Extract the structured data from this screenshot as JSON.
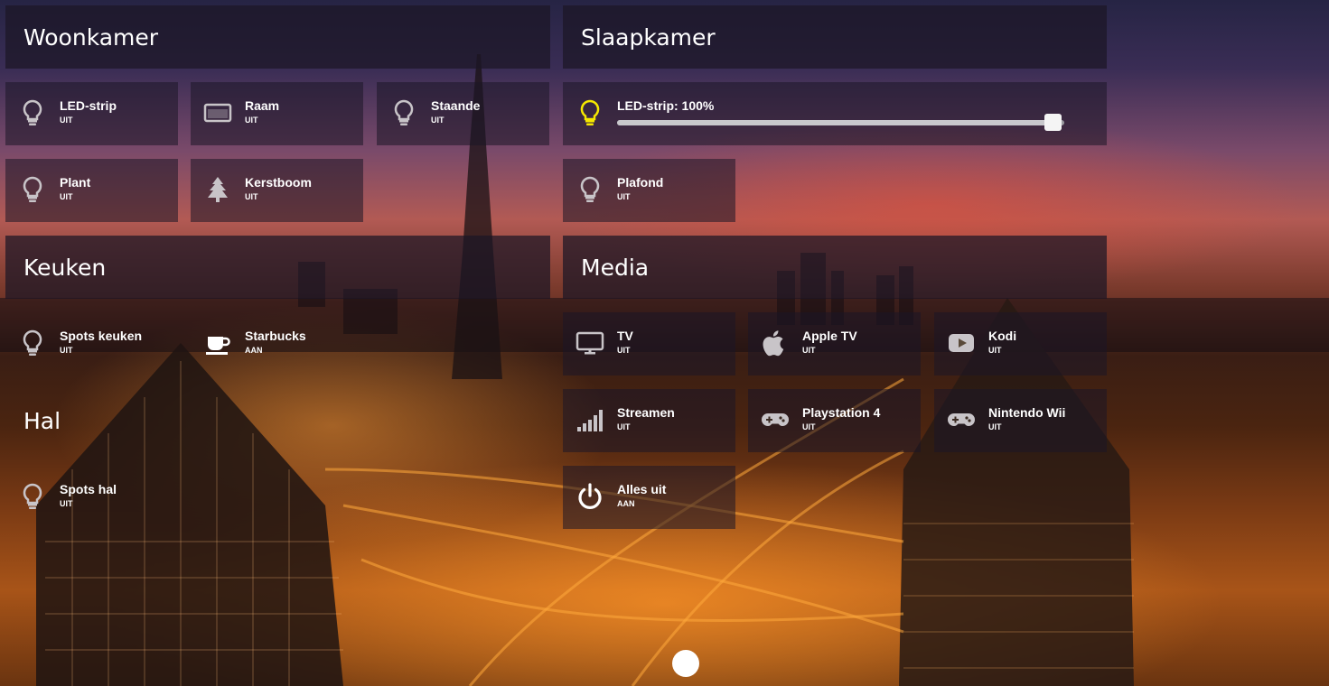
{
  "rooms": {
    "woonkamer": "Woonkamer",
    "slaapkamer": "Slaapkamer",
    "keuken": "Keuken",
    "media": "Media",
    "hal": "Hal"
  },
  "tiles": {
    "ledstrip_woon": {
      "name": "LED-strip",
      "state": "UIT",
      "icon": "bulb-icon"
    },
    "raam": {
      "name": "Raam",
      "state": "UIT",
      "icon": "window-icon"
    },
    "staande": {
      "name": "Staande",
      "state": "UIT",
      "icon": "bulb-icon"
    },
    "plant": {
      "name": "Plant",
      "state": "UIT",
      "icon": "bulb-icon"
    },
    "kerstboom": {
      "name": "Kerstboom",
      "state": "UIT",
      "icon": "tree-icon"
    },
    "plafond": {
      "name": "Plafond",
      "state": "UIT",
      "icon": "bulb-icon"
    },
    "spots_keuken": {
      "name": "Spots keuken",
      "state": "UIT",
      "icon": "bulb-icon"
    },
    "starbucks": {
      "name": "Starbucks",
      "state": "AAN",
      "icon": "coffee-cup-icon"
    },
    "tv": {
      "name": "TV",
      "state": "UIT",
      "icon": "monitor-icon"
    },
    "apple_tv": {
      "name": "Apple TV",
      "state": "UIT",
      "icon": "apple-icon"
    },
    "kodi": {
      "name": "Kodi",
      "state": "UIT",
      "icon": "youtube-icon"
    },
    "streamen": {
      "name": "Streamen",
      "state": "UIT",
      "icon": "signal-bars-icon"
    },
    "playstation": {
      "name": "Playstation 4",
      "state": "UIT",
      "icon": "gamepad-icon"
    },
    "wii": {
      "name": "Nintendo Wii",
      "state": "UIT",
      "icon": "gamepad-icon"
    },
    "spots_hal": {
      "name": "Spots hal",
      "state": "UIT",
      "icon": "bulb-icon"
    },
    "alles_uit": {
      "name": "Alles uit",
      "state": "AAN",
      "icon": "power-icon"
    }
  },
  "slaapkamer_ledstrip": {
    "label": "LED-strip: 100%",
    "brightness": 100,
    "icon": "bulb-icon",
    "icon_color": "#f5e800"
  },
  "colors": {
    "tile_bg": "rgba(28,22,38,0.55)",
    "header_bg": "rgba(28,22,38,0.72)",
    "icon_off": "#c8c4c8",
    "icon_on": "#ffffff",
    "bulb_on": "#f5e800"
  },
  "pager": {
    "pages": 1,
    "current": 1
  }
}
